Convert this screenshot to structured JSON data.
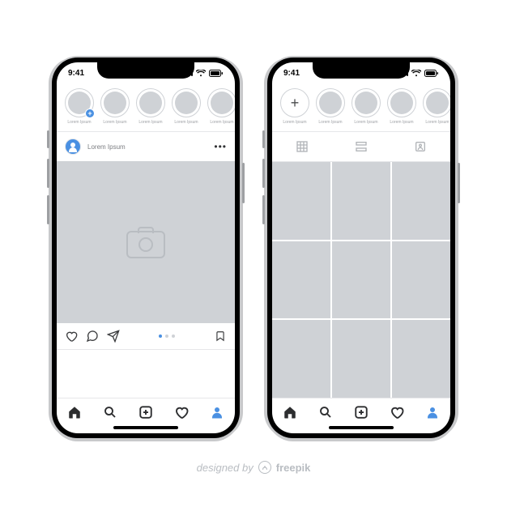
{
  "statusbar": {
    "time": "9:41"
  },
  "stories": {
    "labels": [
      "Lorem Ipsum",
      "Lorem Ipsum",
      "Lorem Ipsum",
      "Lorem Ipsum",
      "Lorem Ipsum"
    ]
  },
  "feed": {
    "username": "Lorem Ipsum",
    "carousel": {
      "dots": 3,
      "active_index": 0
    }
  },
  "profile": {
    "tabs": [
      "grid",
      "list",
      "tagged"
    ],
    "grid_count": 9
  },
  "credit": {
    "prefix": "designed by",
    "brand": "freepik"
  },
  "colors": {
    "accent": "#4a90e2",
    "grey": "#cfd2d6",
    "icon_muted": "#b9bdc2",
    "text_muted": "#9fa2a6"
  }
}
